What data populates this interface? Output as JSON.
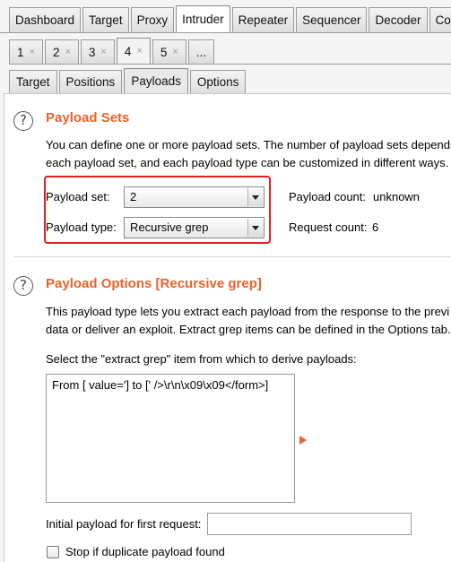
{
  "top_tabs": [
    "Dashboard",
    "Target",
    "Proxy",
    "Intruder",
    "Repeater",
    "Sequencer",
    "Decoder",
    "Com"
  ],
  "active_top_tab": "Intruder",
  "sub_tabs": [
    {
      "label": "1",
      "close": "×"
    },
    {
      "label": "2",
      "close": "×"
    },
    {
      "label": "3",
      "close": "×"
    },
    {
      "label": "4",
      "close": "×"
    },
    {
      "label": "5",
      "close": "×"
    },
    {
      "label": "...",
      "close": ""
    }
  ],
  "active_sub_tab": "4",
  "inner_tabs": [
    "Target",
    "Positions",
    "Payloads",
    "Options"
  ],
  "active_inner_tab": "Payloads",
  "payload_sets": {
    "help_glyph": "?",
    "title": "Payload Sets",
    "desc_line1": "You can define one or more payload sets. The number of payload sets depends",
    "desc_line2": "each payload set, and each payload type can be customized in different ways.",
    "payload_set_label": "Payload set:",
    "payload_set_value": "2",
    "payload_type_label": "Payload type:",
    "payload_type_value": "Recursive grep",
    "payload_count_label": "Payload count:",
    "payload_count_value": "unknown",
    "request_count_label": "Request count:",
    "request_count_value": "6",
    "highlight_color": "#e02020"
  },
  "payload_options": {
    "help_glyph": "?",
    "title": "Payload Options [Recursive grep]",
    "desc_line1": "This payload type lets you extract each payload from the response to the previ",
    "desc_line2": "data or deliver an exploit. Extract grep items can be defined in the Options tab.",
    "select_label": "Select the \"extract grep\" item from which to derive payloads:",
    "grep_items": [
      "From [ value='] to [' />\\r\\n\\x09\\x09</form>]"
    ],
    "initial_payload_label": "Initial payload for first request:",
    "initial_payload_value": "",
    "stop_duplicate_label": "Stop if duplicate payload found",
    "stop_duplicate_checked": false
  },
  "colors": {
    "accent": "#e8632a",
    "highlight": "#e02020"
  }
}
